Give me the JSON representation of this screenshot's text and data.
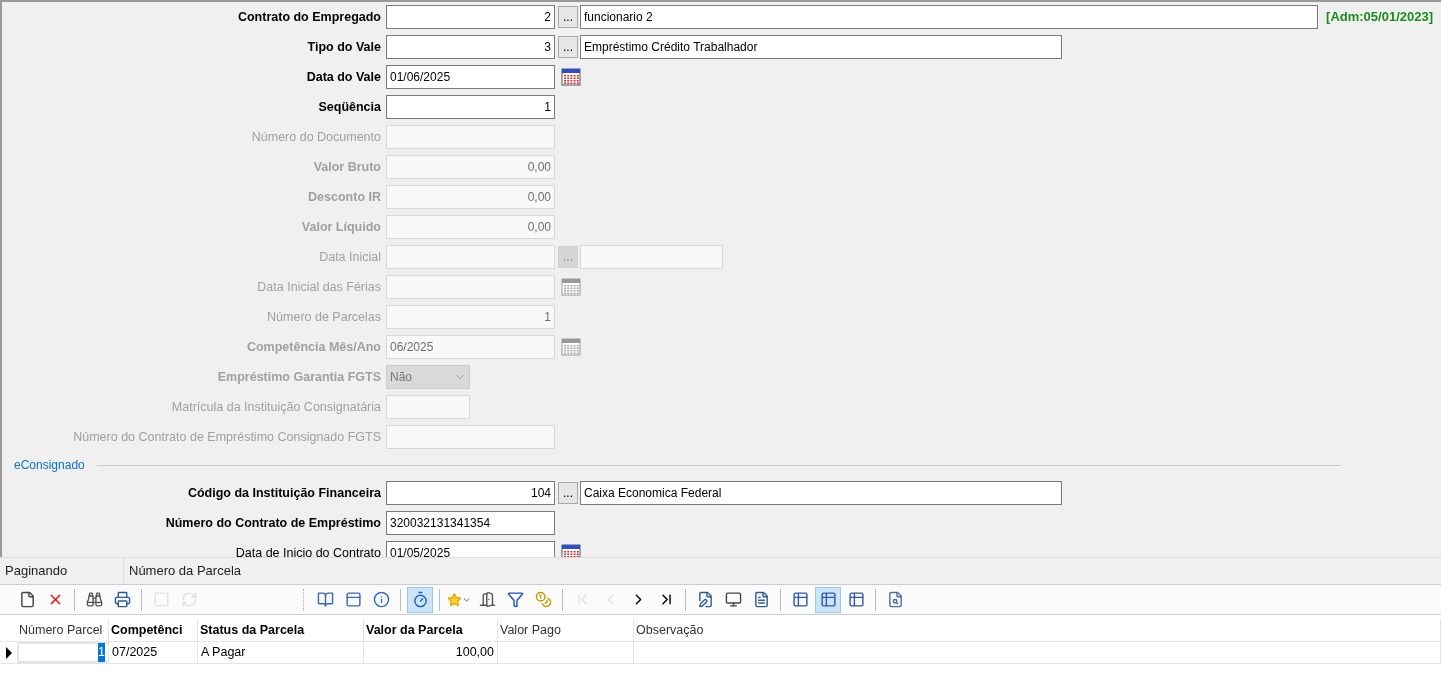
{
  "form": {
    "fields": [
      {
        "kind": "lookup",
        "label": "Contrato do Empregado",
        "bold": true,
        "disabled": false,
        "value": "2",
        "button": "...",
        "description": "funcionario 2",
        "badge": "[Adm:05/01/2023]"
      },
      {
        "kind": "lookup",
        "label": "Tipo do Vale",
        "bold": true,
        "disabled": false,
        "value": "3",
        "button": "...",
        "description": "Empréstimo Crédito Trabalhador"
      },
      {
        "kind": "date",
        "label": "Data do Vale",
        "bold": true,
        "disabled": false,
        "value": "01/06/2025"
      },
      {
        "kind": "number",
        "label": "Seqüência",
        "bold": true,
        "disabled": false,
        "value": "1"
      },
      {
        "kind": "text",
        "label": "Número do Documento",
        "bold": false,
        "disabled": true
      },
      {
        "kind": "number",
        "label": "Valor Bruto",
        "bold": true,
        "disabled": true,
        "value": "0,00"
      },
      {
        "kind": "number",
        "label": "Desconto IR",
        "bold": true,
        "disabled": true,
        "value": "0,00"
      },
      {
        "kind": "number",
        "label": "Valor Líquido",
        "bold": true,
        "disabled": true,
        "value": "0,00"
      },
      {
        "kind": "lookup",
        "label": "Data Inicial",
        "bold": false,
        "disabled": true,
        "button": "..."
      },
      {
        "kind": "date",
        "label": "Data Inicial das Férias",
        "bold": false,
        "disabled": true
      },
      {
        "kind": "number",
        "label": "Número de Parcelas",
        "bold": false,
        "disabled": true,
        "value": "1"
      },
      {
        "kind": "date",
        "label": "Competência Mês/Ano",
        "bold": true,
        "disabled": true,
        "value": "06/2025"
      },
      {
        "kind": "combo",
        "label": "Empréstimo Garantia FGTS",
        "bold": true,
        "disabled": true,
        "value": "Não"
      },
      {
        "kind": "short",
        "label": "Matrícula da Instituição Consignatária",
        "bold": false,
        "disabled": true
      },
      {
        "kind": "text",
        "label": "Número do Contrato de Empréstimo Consignado FGTS",
        "bold": false,
        "disabled": true
      },
      {
        "kind": "section",
        "label": "eConsignado"
      },
      {
        "kind": "lookup",
        "label": "Código da Instituição Financeira",
        "bold": true,
        "disabled": false,
        "value": "104",
        "button": "...",
        "description": "Caixa Economica Federal"
      },
      {
        "kind": "text",
        "label": "Número do Contrato de Empréstimo",
        "bold": true,
        "disabled": false,
        "value": "320032131341354"
      },
      {
        "kind": "date",
        "label": "Data de Inicio do Contrato",
        "bold": false,
        "disabled": false,
        "value": "01/05/2025"
      }
    ]
  },
  "status_bar": [
    "Paginando",
    "Número da Parcela"
  ],
  "toolbar": [
    {
      "kind": "new",
      "disabled": false,
      "pressed": false
    },
    {
      "kind": "delete",
      "disabled": false,
      "pressed": false
    },
    {
      "kind": "separator"
    },
    {
      "kind": "find",
      "disabled": false,
      "pressed": false
    },
    {
      "kind": "print",
      "disabled": false,
      "pressed": false
    },
    {
      "kind": "separator"
    },
    {
      "kind": "save",
      "disabled": true,
      "pressed": false
    },
    {
      "kind": "refresh",
      "disabled": true,
      "pressed": false
    },
    {
      "kind": "gap"
    },
    {
      "kind": "help",
      "disabled": false,
      "pressed": false
    },
    {
      "kind": "form",
      "disabled": false,
      "pressed": false
    },
    {
      "kind": "info",
      "disabled": false,
      "pressed": false
    },
    {
      "kind": "separator"
    },
    {
      "kind": "timer",
      "disabled": false,
      "pressed": true
    },
    {
      "kind": "separator"
    },
    {
      "kind": "favorite",
      "disabled": false,
      "pressed": false
    },
    {
      "kind": "exit",
      "disabled": false,
      "pressed": false
    },
    {
      "kind": "filter",
      "disabled": false,
      "pressed": false
    },
    {
      "kind": "coins",
      "disabled": false,
      "pressed": false
    },
    {
      "kind": "separator"
    },
    {
      "kind": "first",
      "disabled": true,
      "pressed": false
    },
    {
      "kind": "prev",
      "disabled": true,
      "pressed": false
    },
    {
      "kind": "next",
      "disabled": false,
      "pressed": false
    },
    {
      "kind": "last",
      "disabled": false,
      "pressed": false
    },
    {
      "kind": "separator"
    },
    {
      "kind": "edit",
      "disabled": false,
      "pressed": false
    },
    {
      "kind": "preview",
      "disabled": false,
      "pressed": false
    },
    {
      "kind": "report",
      "disabled": false,
      "pressed": false
    },
    {
      "kind": "separator"
    },
    {
      "kind": "grid",
      "disabled": false,
      "pressed": false
    },
    {
      "kind": "grid",
      "disabled": false,
      "pressed": true
    },
    {
      "kind": "grid",
      "disabled": false,
      "pressed": false
    },
    {
      "kind": "separator"
    },
    {
      "kind": "search",
      "disabled": false,
      "pressed": false
    }
  ],
  "table": {
    "columns": [
      {
        "label": "Número Parcel",
        "bold": false
      },
      {
        "label": "Competênci",
        "bold": true
      },
      {
        "label": "Status da Parcela",
        "bold": true
      },
      {
        "label": "Valor da Parcela",
        "bold": true
      },
      {
        "label": "Valor Pago",
        "bold": false
      },
      {
        "label": "Observação",
        "bold": false
      }
    ],
    "rows": [
      {
        "selected": true,
        "cells": [
          "1",
          "07/2025",
          "A Pagar",
          "100,00",
          "",
          ""
        ]
      }
    ]
  }
}
